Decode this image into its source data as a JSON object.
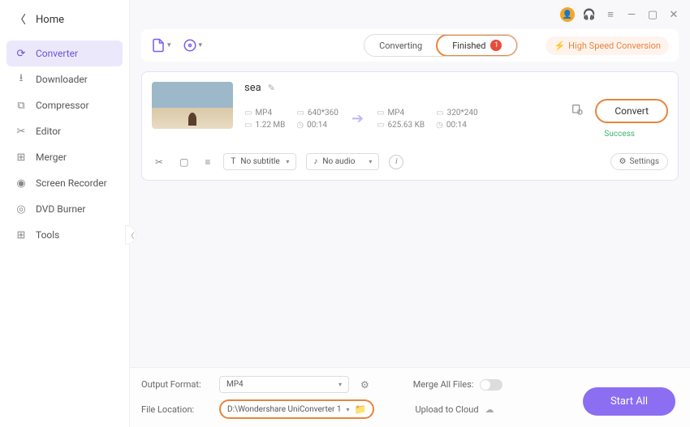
{
  "header": {
    "home": "Home"
  },
  "sidebar": {
    "items": [
      {
        "label": "Converter"
      },
      {
        "label": "Downloader"
      },
      {
        "label": "Compressor"
      },
      {
        "label": "Editor"
      },
      {
        "label": "Merger"
      },
      {
        "label": "Screen Recorder"
      },
      {
        "label": "DVD Burner"
      },
      {
        "label": "Tools"
      }
    ]
  },
  "toolbar": {
    "tabs": {
      "converting": "Converting",
      "finished": "Finished",
      "finished_badge": "1"
    },
    "hsc": "High Speed Conversion"
  },
  "task": {
    "title": "sea",
    "src": {
      "format": "MP4",
      "res": "640*360",
      "size": "1.22 MB",
      "dur": "00:14"
    },
    "dst": {
      "format": "MP4",
      "res": "320*240",
      "size": "625.63 KB",
      "dur": "00:14"
    },
    "convert": "Convert",
    "status": "Success",
    "subtitle": "No subtitle",
    "audio": "No audio",
    "settings": "Settings"
  },
  "bottom": {
    "output_label": "Output Format:",
    "output_value": "MP4",
    "merge_label": "Merge All Files:",
    "file_loc_label": "File Location:",
    "file_loc_value": "D:\\Wondershare UniConverter 1",
    "upload_label": "Upload to Cloud",
    "start_all": "Start All"
  }
}
